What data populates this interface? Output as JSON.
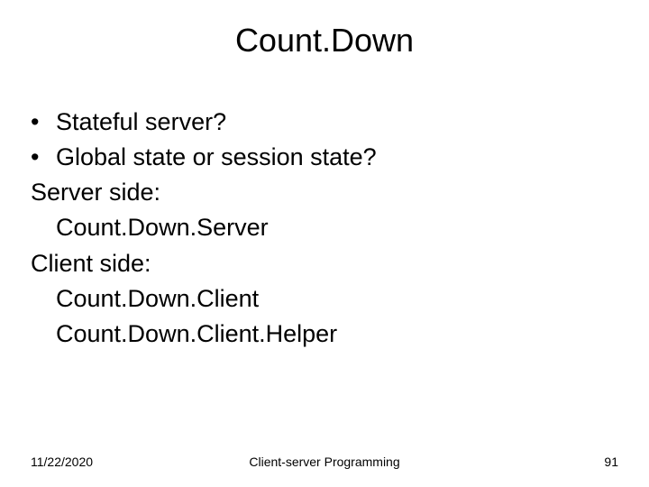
{
  "title": "Count.Down",
  "bullets": [
    "Stateful server?",
    "Global state or session state?"
  ],
  "lines": {
    "server_side_label": "Server side:",
    "server_class": "Count.Down.Server",
    "client_side_label": "Client side:",
    "client_class": "Count.Down.Client",
    "client_helper_class": "Count.Down.Client.Helper"
  },
  "footer": {
    "date": "11/22/2020",
    "title": "Client-server Programming",
    "page": "91"
  }
}
